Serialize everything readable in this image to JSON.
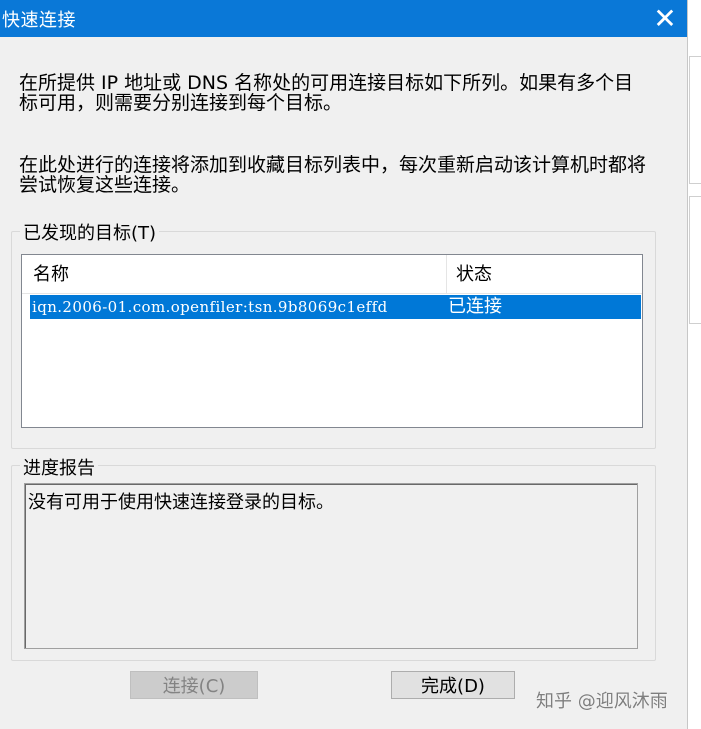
{
  "window": {
    "title": "快速连接",
    "close_glyph": "✕"
  },
  "description": {
    "line1a": "在所提供 IP 地址或 DNS 名称处的可用连接目标如下所列。如果有多个目",
    "line1b": "标可用，则需要分别连接到每个目标。",
    "line2a": "在此处进行的连接将添加到收藏目标列表中，每次重新启动该计算机时都将",
    "line2b": "尝试恢复这些连接。"
  },
  "targets_group": {
    "label": "已发现的目标(T)",
    "columns": [
      "名称",
      "状态"
    ],
    "rows": [
      {
        "name": "iqn.2006-01.com.openfiler:tsn.9b8069c1effd",
        "status": "已连接",
        "selected": true
      }
    ]
  },
  "progress_group": {
    "label": "进度报告",
    "text": "没有可用于使用快速连接登录的目标。"
  },
  "buttons": {
    "connect": {
      "label": "连接(C)",
      "enabled": false
    },
    "done": {
      "label": "完成(D)",
      "enabled": true
    }
  },
  "watermark": "知乎 @迎风沐雨",
  "colors": {
    "titlebar": "#0a78d7",
    "selection": "#0078d7",
    "dialog_bg": "#f0f0f0"
  },
  "icons": {
    "close": "close-icon"
  }
}
